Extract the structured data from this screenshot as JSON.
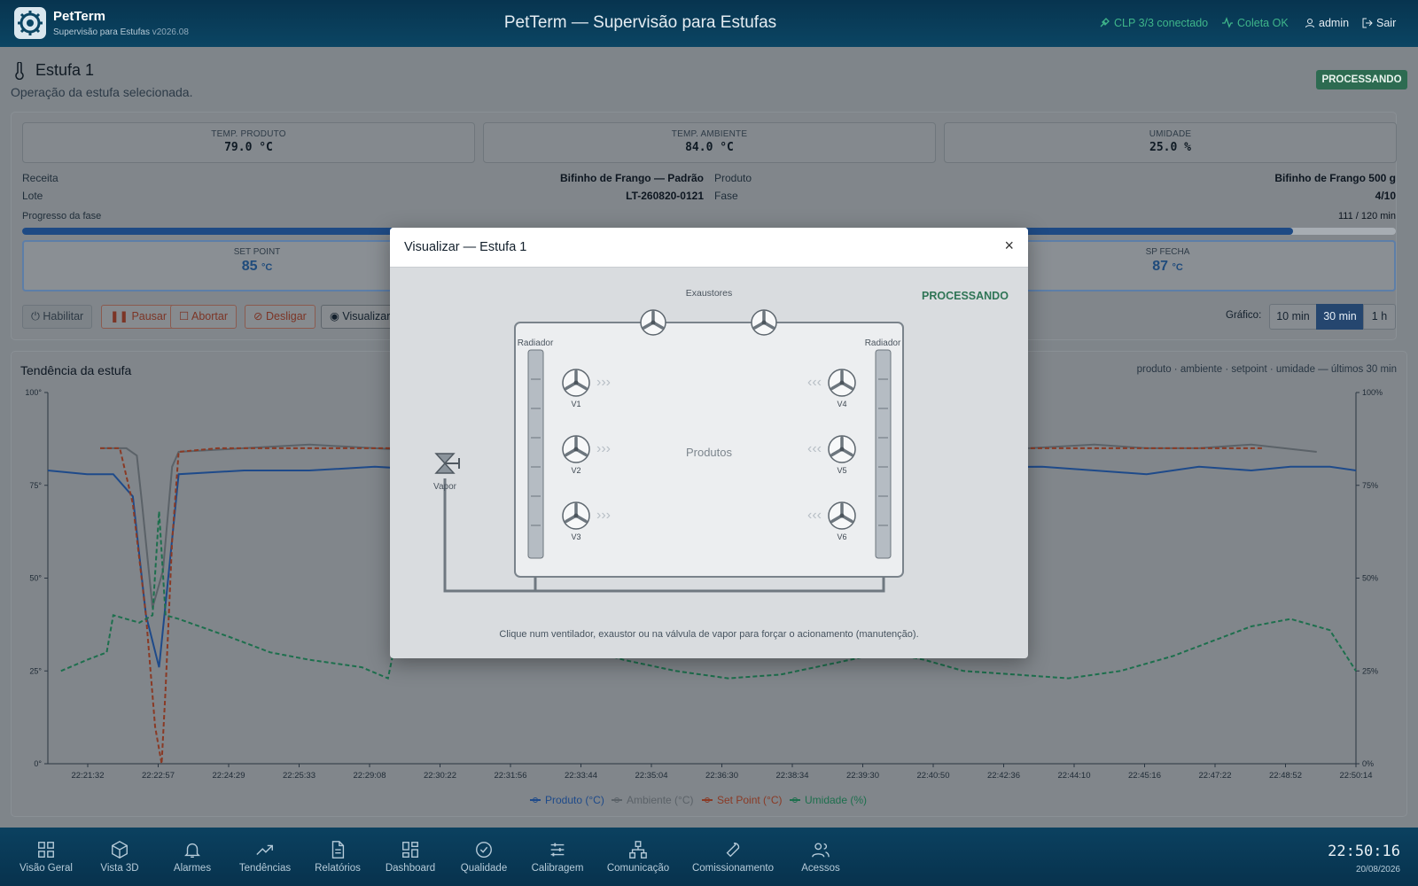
{
  "header": {
    "brand": "PetTerm",
    "subtitle": "Supervisão para Estufas",
    "version": "v2026.08",
    "title": "PetTerm — Supervisão para Estufas",
    "clp_status": "CLP 3/3 conectado",
    "coleta_status": "Coleta OK",
    "user": "admin",
    "logout": "Sair"
  },
  "page": {
    "title": "Estufa 1",
    "subtitle": "Operação da estufa selecionada.",
    "status_badge": "PROCESSANDO"
  },
  "metrics": [
    {
      "label": "TEMP. PRODUTO",
      "value": "79.0 °C"
    },
    {
      "label": "TEMP. AMBIENTE",
      "value": "84.0 °C"
    },
    {
      "label": "UMIDADE",
      "value": "25.0 %"
    }
  ],
  "info": {
    "receita_label": "Receita",
    "receita": "Bifinho de Frango — Padrão",
    "lote_label": "Lote",
    "lote": "LT-260820-0121",
    "produto_label": "Produto",
    "produto": "Bifinho de Frango 500 g",
    "fase_label": "Fase",
    "fase": "4/10"
  },
  "progress": {
    "label": "Progresso da fase",
    "text": "111 / 120 min",
    "fraction": 0.925
  },
  "setpoints": [
    {
      "label": "SET POINT",
      "value": "85",
      "unit": "°C"
    },
    {
      "label": "SP FECHA",
      "value": "87",
      "unit": "°C"
    }
  ],
  "buttons": {
    "habilitar": "Habilitar",
    "pausar": "Pausar",
    "abortar": "Abortar",
    "desligar": "Desligar",
    "visualizar": "Visualizar"
  },
  "chart_range": {
    "label": "Gráfico:",
    "options": [
      "10 min",
      "30 min",
      "1 h"
    ],
    "selected": "30 min"
  },
  "trend": {
    "title": "Tendência da estufa",
    "note": "produto · ambiente · setpoint · umidade — últimos 30 min"
  },
  "chart_data": {
    "type": "line",
    "x": [
      "22:21:32",
      "22:22:57",
      "22:24:29",
      "22:25:33",
      "22:29:08",
      "22:30:22",
      "22:31:56",
      "22:33:44",
      "22:35:04",
      "22:36:30",
      "22:38:34",
      "22:39:30",
      "22:40:50",
      "22:42:36",
      "22:44:10",
      "22:45:16",
      "22:47:22",
      "22:48:52",
      "22:50:14"
    ],
    "y_left": {
      "ticks": [
        "0°",
        "25°",
        "50°",
        "75°",
        "100°"
      ],
      "range": [
        0,
        100
      ]
    },
    "y_right": {
      "ticks": [
        "0%",
        "25%",
        "50%",
        "75%",
        "100%"
      ],
      "range": [
        0,
        100
      ]
    },
    "legend_position": "bottom",
    "grid": false,
    "series": [
      {
        "name": "Produto (°C)",
        "color": "#1e4a8a",
        "dash": false,
        "points": [
          [
            0,
            79
          ],
          [
            0.03,
            78
          ],
          [
            0.05,
            78
          ],
          [
            0.065,
            72
          ],
          [
            0.075,
            40
          ],
          [
            0.085,
            26
          ],
          [
            0.092,
            50
          ],
          [
            0.1,
            78
          ],
          [
            0.15,
            79
          ],
          [
            0.2,
            79
          ],
          [
            0.25,
            80
          ],
          [
            0.3,
            79
          ],
          [
            0.35,
            79
          ],
          [
            0.76,
            80
          ],
          [
            0.8,
            79
          ],
          [
            0.84,
            78
          ],
          [
            0.88,
            80
          ],
          [
            0.92,
            79
          ],
          [
            0.95,
            80
          ],
          [
            0.98,
            80
          ],
          [
            1,
            79
          ]
        ]
      },
      {
        "name": "Ambiente (°C)",
        "color": "#5b6268",
        "dash": false,
        "points": [
          [
            0.04,
            85
          ],
          [
            0.06,
            85
          ],
          [
            0.068,
            83
          ],
          [
            0.072,
            70
          ],
          [
            0.08,
            42
          ],
          [
            0.088,
            52
          ],
          [
            0.095,
            80
          ],
          [
            0.1,
            84
          ],
          [
            0.15,
            85
          ],
          [
            0.2,
            86
          ],
          [
            0.25,
            85
          ],
          [
            0.3,
            84
          ],
          [
            0.32,
            85
          ],
          [
            0.75,
            85
          ],
          [
            0.8,
            86
          ],
          [
            0.84,
            85
          ],
          [
            0.88,
            85
          ],
          [
            0.92,
            86
          ],
          [
            0.97,
            84
          ]
        ]
      },
      {
        "name": "Set Point (°C)",
        "color": "#8a3a25",
        "dash": true,
        "points": [
          [
            0.04,
            85
          ],
          [
            0.055,
            85
          ],
          [
            0.065,
            70
          ],
          [
            0.075,
            40
          ],
          [
            0.082,
            10
          ],
          [
            0.087,
            0
          ],
          [
            0.09,
            20
          ],
          [
            0.095,
            60
          ],
          [
            0.1,
            84
          ],
          [
            0.13,
            85
          ],
          [
            0.3,
            85
          ],
          [
            0.32,
            85
          ],
          [
            0.75,
            85
          ],
          [
            0.8,
            85
          ],
          [
            0.9,
            85
          ],
          [
            0.93,
            85
          ]
        ]
      },
      {
        "name": "Umidade (%)",
        "color": "#1d6f4d",
        "dash": true,
        "points": [
          [
            0.01,
            25
          ],
          [
            0.03,
            28
          ],
          [
            0.045,
            30
          ],
          [
            0.05,
            40
          ],
          [
            0.07,
            38
          ],
          [
            0.08,
            40
          ],
          [
            0.085,
            68
          ],
          [
            0.09,
            40
          ],
          [
            0.1,
            39
          ],
          [
            0.14,
            34
          ],
          [
            0.17,
            30
          ],
          [
            0.2,
            28
          ],
          [
            0.24,
            26
          ],
          [
            0.26,
            23
          ],
          [
            0.27,
            40
          ],
          [
            0.3,
            38
          ],
          [
            0.33,
            36
          ],
          [
            0.36,
            34
          ],
          [
            0.4,
            32
          ],
          [
            0.44,
            28
          ],
          [
            0.48,
            25
          ],
          [
            0.52,
            23
          ],
          [
            0.56,
            24
          ],
          [
            0.6,
            27
          ],
          [
            0.64,
            30
          ],
          [
            0.67,
            28
          ],
          [
            0.7,
            25
          ],
          [
            0.74,
            24
          ],
          [
            0.78,
            23
          ],
          [
            0.82,
            25
          ],
          [
            0.86,
            29
          ],
          [
            0.89,
            33
          ],
          [
            0.92,
            37
          ],
          [
            0.95,
            39
          ],
          [
            0.98,
            36
          ],
          [
            1,
            25
          ]
        ]
      }
    ]
  },
  "modal": {
    "title": "Visualizar — Estufa 1",
    "close": "×",
    "status": "PROCESSANDO",
    "exaustores_label": "Exaustores",
    "radiador_left": "Radiador",
    "radiador_right": "Radiador",
    "produtos_label": "Produtos",
    "vapor_label": "Vapor",
    "ventiladores": [
      "V1",
      "V2",
      "V3",
      "V4",
      "V5",
      "V6"
    ],
    "footer": "Clique num ventilador, exaustor ou na válvula de vapor para forçar o acionamento (manutenção)."
  },
  "nav": [
    {
      "label": "Visão Geral",
      "icon": "grid-icon"
    },
    {
      "label": "Vista 3D",
      "icon": "cube-icon"
    },
    {
      "label": "Alarmes",
      "icon": "bell-icon"
    },
    {
      "label": "Tendências",
      "icon": "trending-icon"
    },
    {
      "label": "Relatórios",
      "icon": "document-icon"
    },
    {
      "label": "Dashboard",
      "icon": "dashboard-icon"
    },
    {
      "label": "Qualidade",
      "icon": "check-circle-icon"
    },
    {
      "label": "Calibragem",
      "icon": "sliders-icon"
    },
    {
      "label": "Comunicação",
      "icon": "network-icon"
    },
    {
      "label": "Comissionamento",
      "icon": "wrench-icon"
    },
    {
      "label": "Acessos",
      "icon": "users-icon"
    }
  ],
  "clock": {
    "time": "22:50:16",
    "date": "20/08/2026"
  }
}
